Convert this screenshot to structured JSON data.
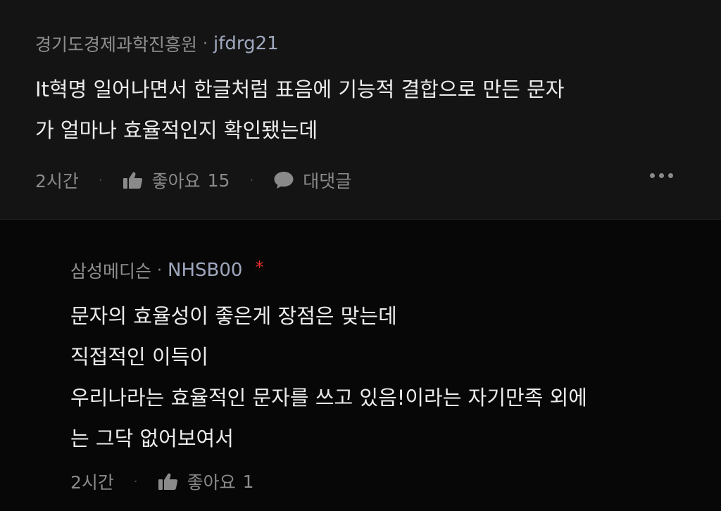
{
  "comments": [
    {
      "company": "경기도경제과학진흥원",
      "separator": "·",
      "nickname": "jfdrg21",
      "lines": [
        "It혁명 일어나면서 한글처럼 표음에 기능적 결합으로 만든 문자",
        "가 얼마나 효율적인지 확인됐는데"
      ],
      "time": "2시간",
      "like_label": "좋아요",
      "like_count": "15",
      "reply_label": "대댓글"
    },
    {
      "company": "삼성메디슨",
      "separator": "·",
      "nickname": "NHSB00",
      "author_marker": "*",
      "lines": [
        "문자의 효율성이 좋은게 장점은 맞는데",
        "직접적인 이득이",
        "우리나라는 효율적인 문자를 쓰고 있음!이라는 자기만족 외에",
        "는 그닥 없어보여서"
      ],
      "time": "2시간",
      "like_label": "좋아요",
      "like_count": "1"
    }
  ],
  "action_separator": "·",
  "icons": {
    "like": "thumbs-up-icon",
    "reply": "speech-bubble-icon",
    "more": "more-dots-icon"
  },
  "colors": {
    "background": "#000000",
    "main_comment_bg": "#141414",
    "body_text": "#ececec",
    "meta_text": "#8e8e8e",
    "nickname": "#9fa8be",
    "author_marker": "#e0302a"
  }
}
